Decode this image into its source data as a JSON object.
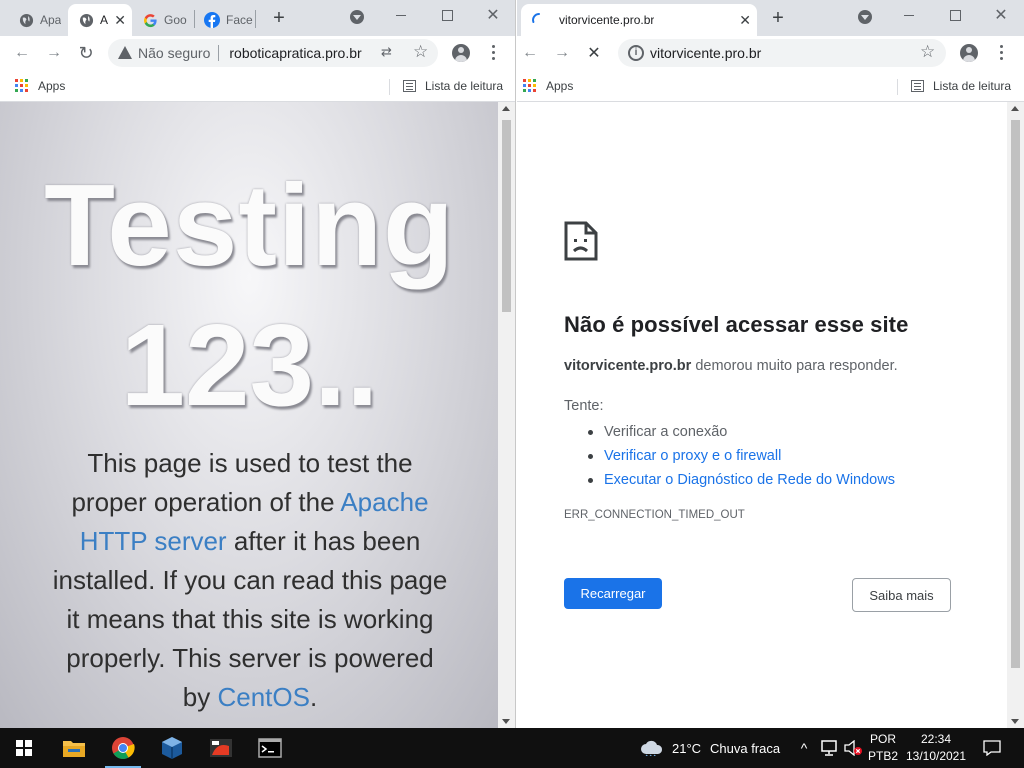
{
  "left_window": {
    "tabs": [
      {
        "label": "Apa",
        "icon": "globe-icon",
        "active": false
      },
      {
        "label": "A",
        "icon": "globe-icon",
        "active": true
      },
      {
        "label": "Goo",
        "icon": "google-icon",
        "active": false
      },
      {
        "label": "Face",
        "icon": "facebook-icon",
        "active": false
      }
    ],
    "omnibox": {
      "security_label": "Não seguro",
      "url": "roboticapratica.pro.br"
    },
    "bookmarks": {
      "apps_label": "Apps",
      "reading_list_label": "Lista de leitura"
    },
    "page": {
      "hero_line1": "Testing",
      "hero_line2": "123..",
      "body_part1": "This page is used to test the proper operation of the ",
      "link_apache": "Apache HTTP server",
      "body_part2": " after it has been installed. If you can read this page it means that this site is working properly. This server is powered by ",
      "link_centos": "CentOS",
      "body_part3": "."
    }
  },
  "right_window": {
    "tab": {
      "label": "vitorvicente.pro.br",
      "icon": "loading-spinner-icon"
    },
    "omnibox": {
      "url": "vitorvicente.pro.br"
    },
    "bookmarks": {
      "apps_label": "Apps",
      "reading_list_label": "Lista de leitura"
    },
    "error": {
      "title": "Não é possível acessar esse site",
      "site": "vitorvicente.pro.br",
      "desc_suffix": " demorou muito para responder.",
      "try_label": "Tente:",
      "suggestions": [
        "Verificar a conexão",
        "Verificar o proxy e o firewall",
        "Executar o Diagnóstico de Rede do Windows"
      ],
      "code": "ERR_CONNECTION_TIMED_OUT",
      "reload_button": "Recarregar",
      "more_button": "Saiba mais"
    }
  },
  "taskbar": {
    "weather": {
      "temp": "21°C",
      "condition": "Chuva fraca"
    },
    "language": {
      "line1": "POR",
      "line2": "PTB2"
    },
    "clock": {
      "time": "22:34",
      "date": "13/10/2021"
    }
  },
  "colors": {
    "link": "#3b7fc4",
    "chrome_blue": "#1a73e8",
    "tabstrip": "#dee1e6",
    "taskbar": "#101010"
  }
}
